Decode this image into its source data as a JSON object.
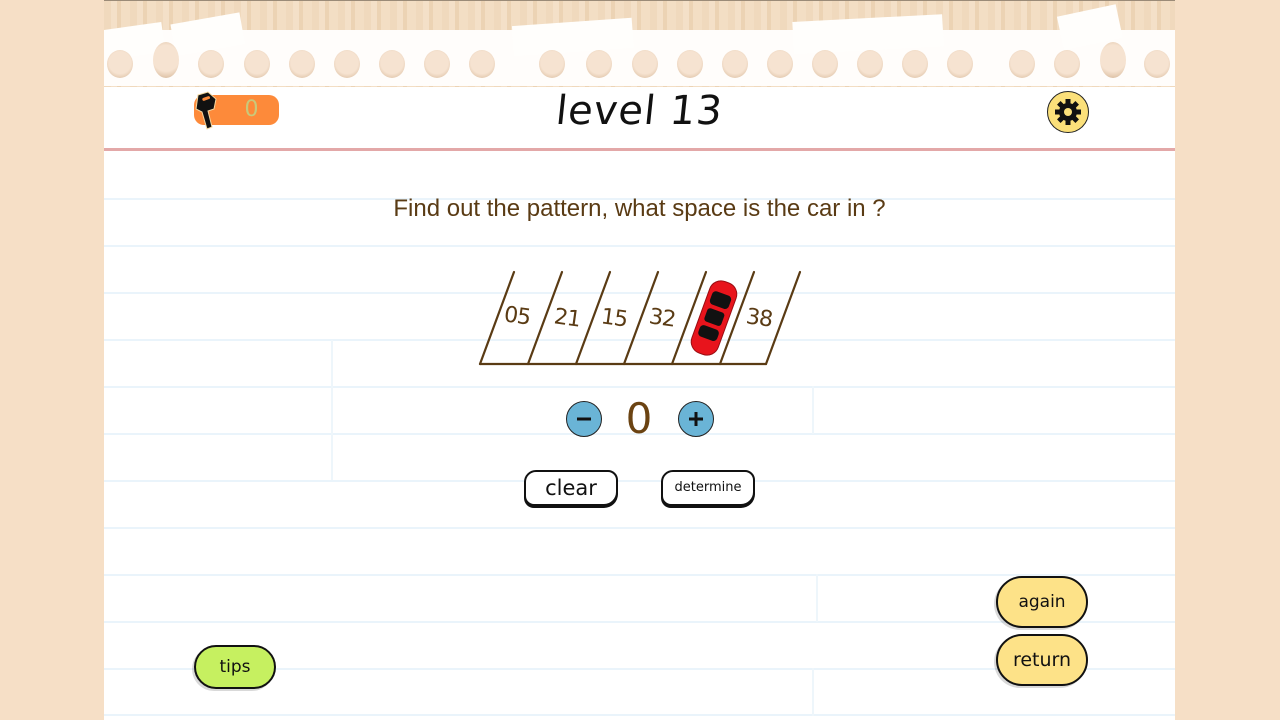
{
  "header": {
    "keys_count": "0",
    "level_label": "level 13",
    "settings_icon": "gear-icon",
    "key_icon": "key-icon"
  },
  "puzzle": {
    "question": "Find out the pattern, what space is the car in ?",
    "spaces": [
      "05",
      "21",
      "15",
      "32",
      "",
      "38"
    ],
    "car_space_index": 4,
    "car_color": "#e8141c"
  },
  "answer": {
    "value": "0",
    "decrement_label": "−",
    "increment_label": "+"
  },
  "actions": {
    "clear_label": "clear",
    "determine_label": "determine",
    "tips_label": "tips",
    "again_label": "again",
    "return_label": "return"
  },
  "colors": {
    "background": "#f6dfc6",
    "key_badge": "#fd8a3a",
    "gear_bg": "#fbe07a",
    "round_btn": "#6ab4d6",
    "tips_btn": "#c6f060",
    "yellow_btn": "#fde288",
    "text_brown": "#5a3b14",
    "margin_line": "#e3a8a8"
  }
}
